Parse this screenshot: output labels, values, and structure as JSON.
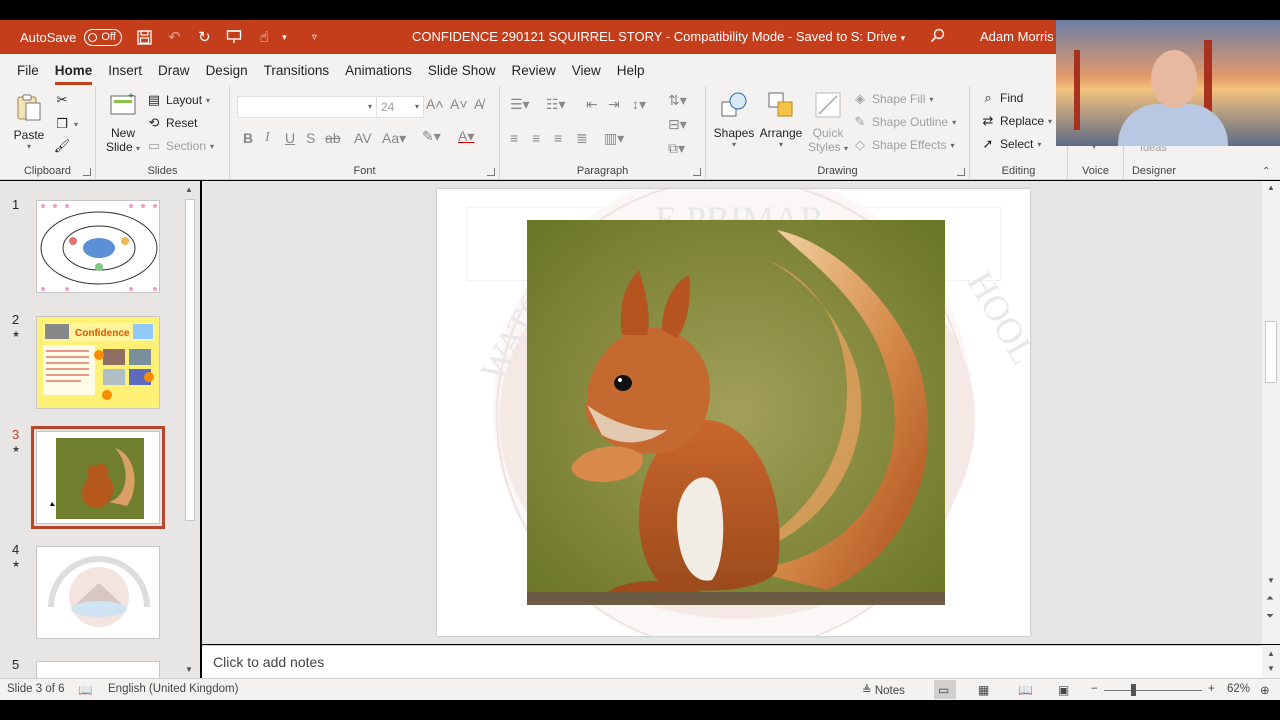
{
  "titlebar": {
    "autosave_label": "AutoSave",
    "autosave_state": "Off",
    "document_title": "CONFIDENCE  290121 SQUIRREL STORY  -  Compatibility Mode  -  Saved to S: Drive",
    "user_name": "Adam Morris"
  },
  "menu": {
    "tabs": [
      "File",
      "Home",
      "Insert",
      "Draw",
      "Design",
      "Transitions",
      "Animations",
      "Slide Show",
      "Review",
      "View",
      "Help"
    ],
    "active": "Home"
  },
  "ribbon": {
    "clipboard": {
      "label": "Clipboard",
      "paste": "Paste"
    },
    "slides": {
      "label": "Slides",
      "new_slide_1": "New",
      "new_slide_2": "Slide",
      "layout": "Layout",
      "reset": "Reset",
      "section": "Section"
    },
    "font": {
      "label": "Font",
      "font_size": "24"
    },
    "paragraph": {
      "label": "Paragraph"
    },
    "drawing": {
      "label": "Drawing",
      "shapes": "Shapes",
      "arrange": "Arrange",
      "quick_styles_1": "Quick",
      "quick_styles_2": "Styles",
      "shape_fill": "Shape Fill",
      "shape_outline": "Shape Outline",
      "shape_effects": "Shape Effects"
    },
    "editing": {
      "label": "Editing",
      "find": "Find",
      "replace": "Replace",
      "select": "Select"
    },
    "voice": {
      "label": "Voice"
    },
    "designer": {
      "label": "Designer",
      "ideas": "Ideas"
    }
  },
  "slides_panel": {
    "thumbnails": [
      {
        "number": "1",
        "starred": false
      },
      {
        "number": "2",
        "starred": true,
        "title": "Confidence"
      },
      {
        "number": "3",
        "starred": true,
        "selected": true
      },
      {
        "number": "4",
        "starred": true
      },
      {
        "number": "5",
        "starred": true
      }
    ]
  },
  "slide": {
    "watermark_left": "WATCO",
    "watermark_top": "E PRIMAR",
    "watermark_right": "HOOL"
  },
  "notes": {
    "placeholder": "Click to add notes"
  },
  "statusbar": {
    "slide_info": "Slide 3 of 6",
    "language": "English (United Kingdom)",
    "notes_button": "Notes",
    "zoom": "62%"
  },
  "colors": {
    "accent": "#c43e1c",
    "ribbon_bg": "#f3f2f1",
    "selection_outline": "#b7472a"
  }
}
